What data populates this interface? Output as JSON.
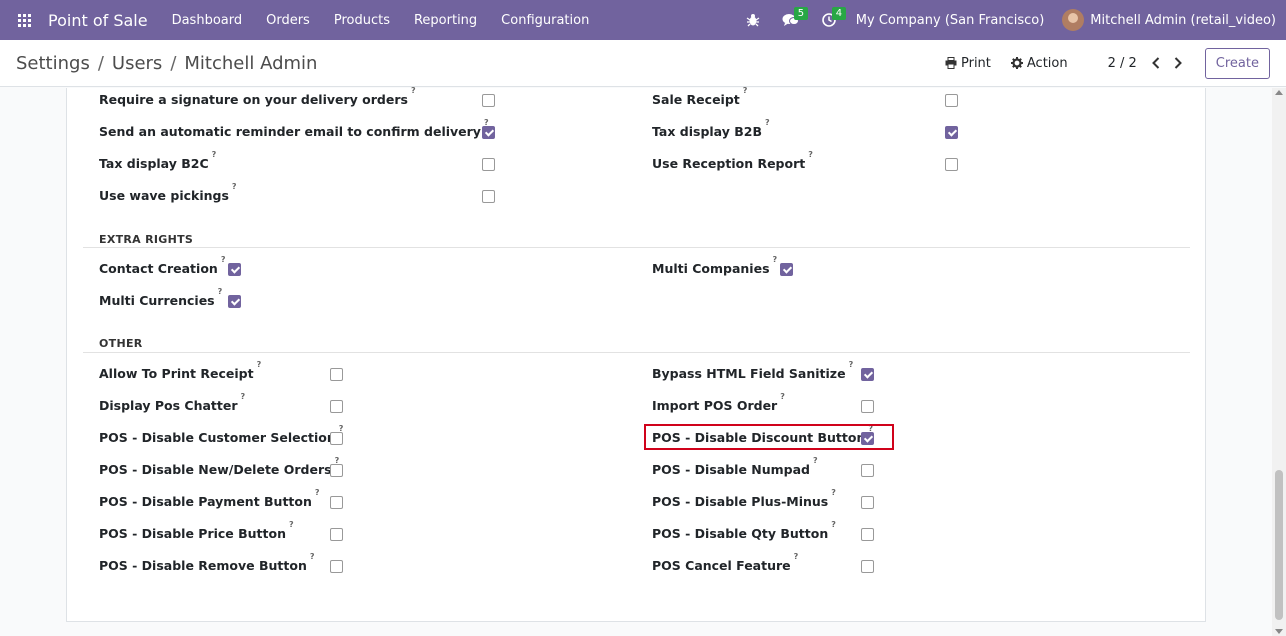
{
  "navbar": {
    "app_name": "Point of Sale",
    "menu": [
      "Dashboard",
      "Orders",
      "Products",
      "Reporting",
      "Configuration"
    ],
    "messages_count": "5",
    "activities_count": "4",
    "company": "My Company (San Francisco)",
    "user": "Mitchell Admin (retail_video)"
  },
  "control": {
    "breadcrumb": [
      "Settings",
      "Users",
      "Mitchell Admin"
    ],
    "print_label": "Print",
    "action_label": "Action",
    "pager": "2 / 2",
    "create_label": "Create"
  },
  "top_left": [
    {
      "label": "Require a signature on your delivery orders",
      "checked": false
    },
    {
      "label": "Send an automatic reminder email to confirm delivery",
      "checked": true
    },
    {
      "label": "Tax display B2C",
      "checked": false
    },
    {
      "label": "Use wave pickings",
      "checked": false
    }
  ],
  "top_right": [
    {
      "label": "Sale Receipt",
      "checked": false
    },
    {
      "label": "Tax display B2B",
      "checked": true
    },
    {
      "label": "Use Reception Report",
      "checked": false
    }
  ],
  "extra_rights": {
    "title": "EXTRA RIGHTS",
    "left": [
      {
        "label": "Contact Creation",
        "checked": true
      },
      {
        "label": "Multi Currencies",
        "checked": true
      }
    ],
    "right": [
      {
        "label": "Multi Companies",
        "checked": true
      }
    ]
  },
  "other": {
    "title": "OTHER",
    "left": [
      {
        "label": "Allow To Print Receipt",
        "checked": false
      },
      {
        "label": "Display Pos Chatter",
        "checked": false
      },
      {
        "label": "POS - Disable Customer Selection",
        "checked": false
      },
      {
        "label": "POS - Disable New/Delete Orders",
        "checked": false
      },
      {
        "label": "POS - Disable Payment Button",
        "checked": false
      },
      {
        "label": "POS - Disable Price Button",
        "checked": false
      },
      {
        "label": "POS - Disable Remove Button",
        "checked": false
      }
    ],
    "right": [
      {
        "label": "Bypass HTML Field Sanitize",
        "checked": true
      },
      {
        "label": "Import POS Order",
        "checked": false
      },
      {
        "label": "POS - Disable Discount Button",
        "checked": true,
        "highlighted": true
      },
      {
        "label": "POS - Disable Numpad",
        "checked": false
      },
      {
        "label": "POS - Disable Plus-Minus",
        "checked": false
      },
      {
        "label": "POS - Disable Qty Button",
        "checked": false
      },
      {
        "label": "POS Cancel Feature",
        "checked": false
      }
    ]
  },
  "help_marker": "?",
  "icons": {
    "apps": "grid-icon",
    "debug": "bug-icon",
    "messages": "chat-icon",
    "activities": "clock-icon",
    "print": "printer-icon",
    "action": "gear-icon"
  }
}
